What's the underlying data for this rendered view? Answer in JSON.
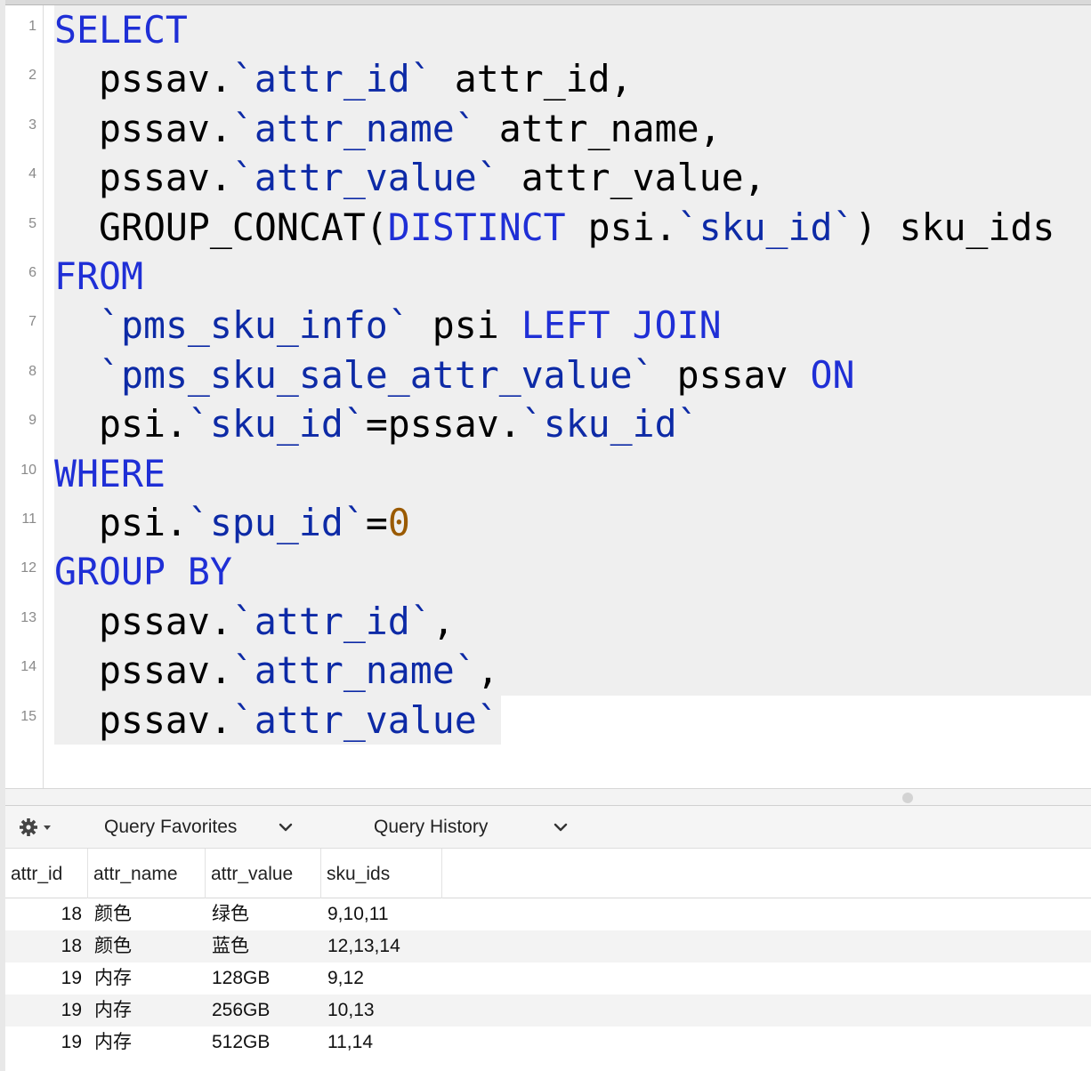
{
  "editor": {
    "line_numbers": [
      "1",
      "2",
      "3",
      "4",
      "5",
      "6",
      "7",
      "8",
      "9",
      "10",
      "11",
      "12",
      "13",
      "14",
      "15"
    ],
    "lines": [
      [
        {
          "t": "SELECT",
          "c": "kw"
        }
      ],
      [
        {
          "t": "  pssav.",
          "c": ""
        },
        {
          "t": "`attr_id`",
          "c": "id"
        },
        {
          "t": " attr_id,",
          "c": ""
        }
      ],
      [
        {
          "t": "  pssav.",
          "c": ""
        },
        {
          "t": "`attr_name`",
          "c": "id"
        },
        {
          "t": " attr_name,",
          "c": ""
        }
      ],
      [
        {
          "t": "  pssav.",
          "c": ""
        },
        {
          "t": "`attr_value`",
          "c": "id"
        },
        {
          "t": " attr_value,",
          "c": ""
        }
      ],
      [
        {
          "t": "  GROUP_CONCAT(",
          "c": ""
        },
        {
          "t": "DISTINCT",
          "c": "kw"
        },
        {
          "t": " psi.",
          "c": ""
        },
        {
          "t": "`sku_id`",
          "c": "id"
        },
        {
          "t": ") sku_ids",
          "c": ""
        }
      ],
      [
        {
          "t": "FROM",
          "c": "kw"
        }
      ],
      [
        {
          "t": "  ",
          "c": ""
        },
        {
          "t": "`pms_sku_info`",
          "c": "id"
        },
        {
          "t": " psi ",
          "c": ""
        },
        {
          "t": "LEFT JOIN",
          "c": "kw"
        }
      ],
      [
        {
          "t": "  ",
          "c": ""
        },
        {
          "t": "`pms_sku_sale_attr_value`",
          "c": "id"
        },
        {
          "t": " pssav ",
          "c": ""
        },
        {
          "t": "ON",
          "c": "kw"
        }
      ],
      [
        {
          "t": "  psi.",
          "c": ""
        },
        {
          "t": "`sku_id`",
          "c": "id"
        },
        {
          "t": "=pssav.",
          "c": ""
        },
        {
          "t": "`sku_id`",
          "c": "id"
        }
      ],
      [
        {
          "t": "WHERE",
          "c": "kw"
        }
      ],
      [
        {
          "t": "  psi.",
          "c": ""
        },
        {
          "t": "`spu_id`",
          "c": "id"
        },
        {
          "t": "=",
          "c": ""
        },
        {
          "t": "0",
          "c": "num"
        }
      ],
      [
        {
          "t": "GROUP BY",
          "c": "kw"
        }
      ],
      [
        {
          "t": "  pssav.",
          "c": ""
        },
        {
          "t": "`attr_id`",
          "c": "id"
        },
        {
          "t": ",",
          "c": ""
        }
      ],
      [
        {
          "t": "  pssav.",
          "c": ""
        },
        {
          "t": "`attr_name`",
          "c": "id"
        },
        {
          "t": ",",
          "c": ""
        }
      ],
      [
        {
          "t": "  pssav.",
          "c": ""
        },
        {
          "t": "`attr_value`",
          "c": "id"
        }
      ]
    ]
  },
  "toolbar": {
    "gear_icon": "gear-icon",
    "favorites_label": "Query Favorites",
    "history_label": "Query History"
  },
  "results": {
    "columns": [
      "attr_id",
      "attr_name",
      "attr_value",
      "sku_ids"
    ],
    "rows": [
      [
        "18",
        "颜色",
        "绿色",
        "9,10,11"
      ],
      [
        "18",
        "颜色",
        "蓝色",
        "12,13,14"
      ],
      [
        "19",
        "内存",
        "128GB",
        "9,12"
      ],
      [
        "19",
        "内存",
        "256GB",
        "10,13"
      ],
      [
        "19",
        "内存",
        "512GB",
        "11,14"
      ]
    ]
  },
  "colors": {
    "keyword": "#1f2fd6",
    "identifier": "#0d2aa6",
    "number": "#9a5a00",
    "highlight": "#efefef"
  }
}
